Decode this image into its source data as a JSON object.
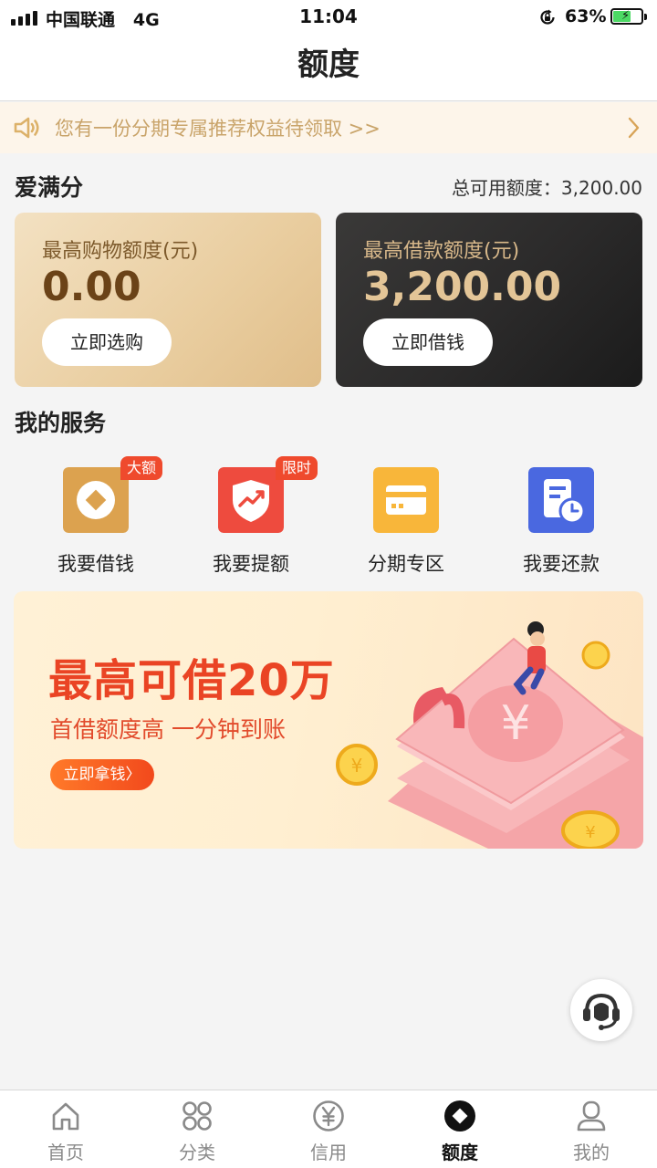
{
  "status_bar": {
    "carrier": "中国联通",
    "network": "4G",
    "time": "11:04",
    "battery_percent": "63%",
    "battery_level": 0.63,
    "battery_color": "#4cd964"
  },
  "header": {
    "title": "额度"
  },
  "notice": {
    "icon": "speaker-icon",
    "text": "您有一份分期专属推荐权益待领取 >>",
    "chevron_icon": "chevron-right-icon"
  },
  "summary": {
    "score_label": "爱满分",
    "total_label": "总可用额度：3,200.00"
  },
  "cards": {
    "shopping": {
      "label": "最高购物额度(元)",
      "amount": "0.00",
      "button": "立即选购"
    },
    "loan": {
      "label": "最高借款额度(元)",
      "amount": "3,200.00",
      "button": "立即借钱"
    }
  },
  "services": {
    "title": "我的服务",
    "items": [
      {
        "label": "我要借钱",
        "badge": "大额",
        "icon": "coin-diamond-icon",
        "color": "#dca24f"
      },
      {
        "label": "我要提额",
        "badge": "限时",
        "icon": "shield-trend-icon",
        "color": "#ee4b3e"
      },
      {
        "label": "分期专区",
        "badge": "",
        "icon": "card-icon",
        "color": "#f8b63a"
      },
      {
        "label": "我要还款",
        "badge": "",
        "icon": "bill-clock-icon",
        "color": "#4a68e0"
      }
    ]
  },
  "banner": {
    "headline": "最高可借20万",
    "subline": "首借额度高  一分钟到账",
    "button": "立即拿钱",
    "button_chevron": "〉"
  },
  "floating": {
    "icon": "customer-service-icon"
  },
  "tabbar": {
    "items": [
      {
        "label": "首页",
        "icon": "home-icon",
        "active": false
      },
      {
        "label": "分类",
        "icon": "grid-icon",
        "active": false
      },
      {
        "label": "信用",
        "icon": "yen-circle-icon",
        "active": false
      },
      {
        "label": "额度",
        "icon": "diamond-circle-icon",
        "active": true
      },
      {
        "label": "我的",
        "icon": "person-icon",
        "active": false
      }
    ]
  }
}
